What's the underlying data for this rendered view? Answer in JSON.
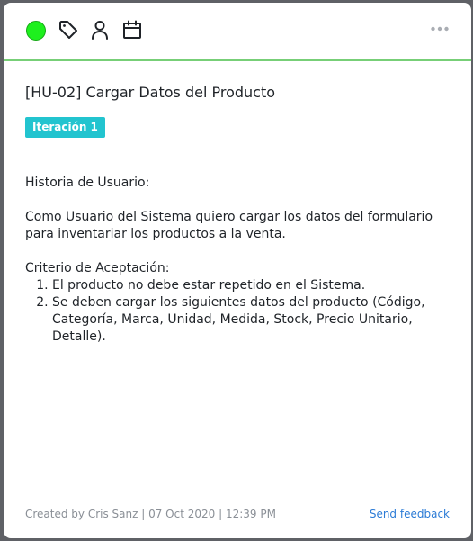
{
  "toolbar": {
    "status_color": "#1ef01e",
    "icons": [
      "tag-icon",
      "user-icon",
      "calendar-icon",
      "more-icon"
    ]
  },
  "card": {
    "title": "[HU-02] Cargar Datos del Producto",
    "badge": "Iteración 1",
    "badge_color": "#22c4cf",
    "description": {
      "heading": "Historia de Usuario:",
      "story": "Como Usuario del Sistema quiero cargar los datos del formulario para inventariar los productos a la venta.",
      "criteria_heading": "Criterio de Aceptación:",
      "criteria": [
        "El producto no debe estar repetido en el Sistema.",
        "Se deben cargar los siguientes datos del producto (Código, Categoría, Marca, Unidad, Medida, Stock, Precio Unitario, Detalle)."
      ]
    }
  },
  "footer": {
    "meta": "Created by Cris Sanz | 07 Oct 2020 | 12:39 PM",
    "feedback_label": "Send feedback",
    "link_color": "#2b7bd6"
  }
}
